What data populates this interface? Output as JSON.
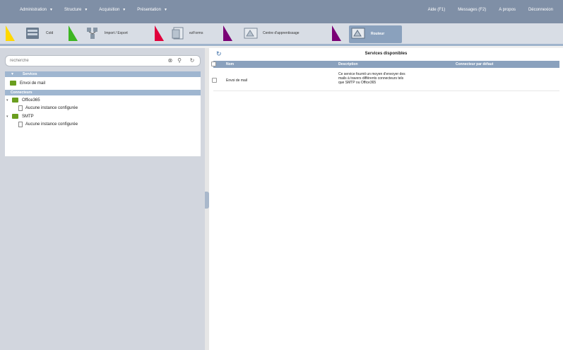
{
  "menubar": {
    "left": [
      {
        "label": "Administration",
        "caret": "▼"
      },
      {
        "label": "Structure",
        "caret": "▼"
      },
      {
        "label": "Acquisition",
        "caret": "▼"
      },
      {
        "label": "Présentation",
        "caret": "▼"
      }
    ],
    "right": [
      "Aide (F1)",
      "Messages (F2)",
      "A propos",
      "Déconnexion"
    ]
  },
  "apps": [
    {
      "label": "Cold",
      "flag": "yellow",
      "icon": "cold-icon"
    },
    {
      "label": "Import / Export",
      "flag": "green",
      "icon": "import-export-icon"
    },
    {
      "label": "ezForms",
      "flag": "red",
      "icon": "forms-icon"
    },
    {
      "label": "Centre d'apprentissage",
      "flag": "purple",
      "icon": "learning-icon"
    },
    {
      "label": "Routeur",
      "flag": "purple",
      "icon": "router-icon",
      "active": true
    }
  ],
  "search": {
    "placeholder": "recherche"
  },
  "tree": {
    "services_header": "Services",
    "services": [
      {
        "label": "Envoi de mail"
      }
    ],
    "connectors_header": "Connecteurs",
    "connectors": [
      {
        "label": "Office365",
        "child": "Aucune instance configurée"
      },
      {
        "label": "SMTP",
        "child": "Aucune instance configurée"
      }
    ]
  },
  "services_panel": {
    "title": "Services disponibles",
    "columns": [
      "Nom",
      "Description",
      "Connecteur par défaut"
    ],
    "rows": [
      {
        "name": "Envoi de mail",
        "description_lines": [
          "Ce service fournit un moyen d'envoyer des",
          "mails à travers différents connecteurs tels",
          "que SMTP ou Office365"
        ],
        "default_connector": ""
      }
    ]
  },
  "colors": {
    "menubar": "#7f8fa6",
    "accent": "#8aa1bd",
    "tree_header": "#9fb6d0",
    "folder": "#6a9e1f"
  }
}
